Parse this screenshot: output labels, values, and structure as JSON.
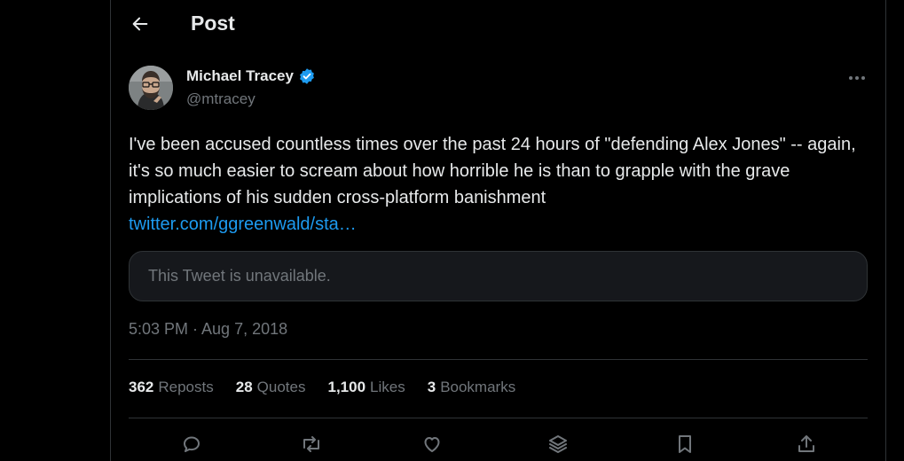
{
  "header": {
    "title": "Post",
    "back_icon": "arrow-left-icon"
  },
  "author": {
    "name": "Michael Tracey",
    "handle": "@mtracey",
    "verified": true,
    "verified_color": "#1d9bf0"
  },
  "tweet": {
    "text": "I've been accused countless times over the past 24 hours of \"defending Alex Jones\" -- again, it's so much easier to scream about how horrible he is than to grapple with the grave implications of his sudden cross-platform banishment",
    "link": "twitter.com/ggreenwald/sta…",
    "quote_unavailable": "This Tweet is unavailable.",
    "timestamp": "5:03 PM · Aug 7, 2018"
  },
  "stats": [
    {
      "count": "362",
      "label": "Reposts"
    },
    {
      "count": "28",
      "label": "Quotes"
    },
    {
      "count": "1,100",
      "label": "Likes"
    },
    {
      "count": "3",
      "label": "Bookmarks"
    }
  ],
  "actions": [
    "reply-icon",
    "repost-icon",
    "like-icon",
    "layers-icon",
    "bookmark-icon",
    "share-icon"
  ],
  "colors": {
    "background": "#000000",
    "text_primary": "#e7e9ea",
    "text_secondary": "#71767b",
    "link": "#1d9bf0",
    "border": "#2f3336"
  }
}
